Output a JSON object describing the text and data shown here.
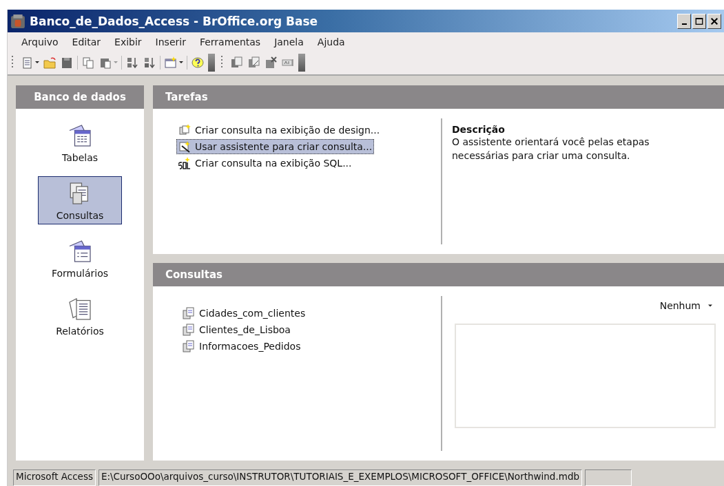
{
  "window": {
    "title": "Banco_de_Dados_Access - BrOffice.org Base"
  },
  "menu": [
    "Arquivo",
    "Editar",
    "Exibir",
    "Inserir",
    "Ferramentas",
    "Janela",
    "Ajuda"
  ],
  "sidebar": {
    "title": "Banco de dados",
    "items": [
      {
        "label": "Tabelas",
        "kind": "table",
        "selected": false
      },
      {
        "label": "Consultas",
        "kind": "query",
        "selected": true
      },
      {
        "label": "Formulários",
        "kind": "form",
        "selected": false
      },
      {
        "label": "Relatórios",
        "kind": "report",
        "selected": false
      }
    ]
  },
  "tasks": {
    "title": "Tarefas",
    "items": [
      {
        "label": "Criar consulta na exibição de design...",
        "kind": "design",
        "selected": false
      },
      {
        "label": "Usar assistente para criar consulta...",
        "kind": "wizard",
        "selected": true
      },
      {
        "label": "Criar consulta na exibição SQL...",
        "kind": "sql",
        "selected": false
      }
    ],
    "description": {
      "title": "Descrição",
      "text": "O assistente orientará você pelas etapas necessárias para criar uma consulta."
    }
  },
  "queries": {
    "title": "Consultas",
    "items": [
      {
        "label": "Cidades_com_clientes",
        "selected": false
      },
      {
        "label": "Clientes_de_Lisboa",
        "selected": false
      },
      {
        "label": "Informacoes_Pedidos",
        "selected": false
      }
    ],
    "preview": {
      "value": "Nenhum"
    }
  },
  "status_bar": [
    "Microsoft Access",
    "E:\\CursoOOo\\arquivos_curso\\INSTRUTOR\\TUTORIAIS_E_EXEMPLOS\\MICROSOFT_OFFICE\\Northwind.mdb"
  ]
}
